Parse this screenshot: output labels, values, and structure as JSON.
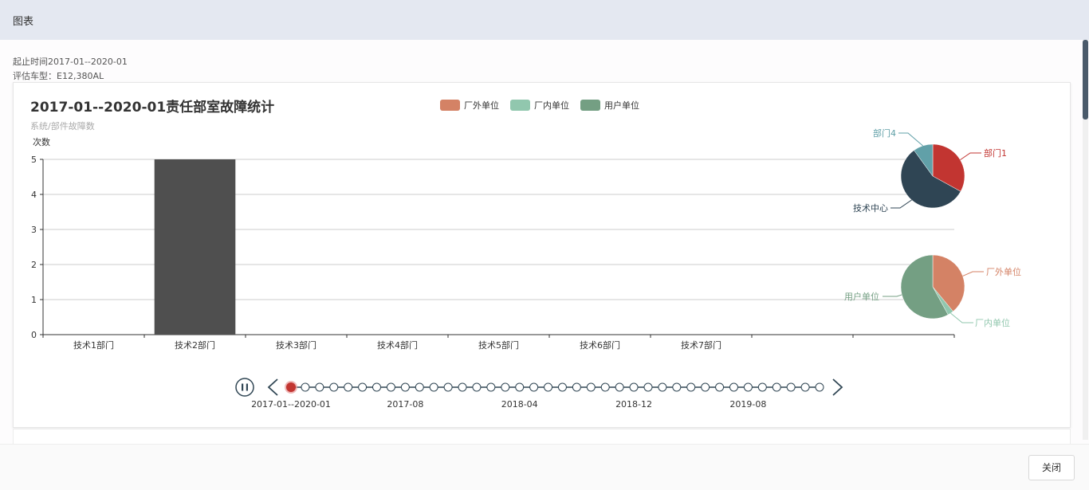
{
  "header": {
    "title": "图表"
  },
  "info": {
    "time_range": "起止时间2017-01--2020-01",
    "vehicle_model": "评估车型：E12,380AL"
  },
  "chart": {
    "title": "2017-01--2020-01责任部室故障统计",
    "subtitle": "系统/部件故障数",
    "legend": [
      {
        "name": "厂外单位",
        "color": "#d48265"
      },
      {
        "name": "厂内单位",
        "color": "#91c7ae"
      },
      {
        "name": "用户单位",
        "color": "#749f83"
      }
    ]
  },
  "chart_data": [
    {
      "type": "bar",
      "title": "2017-01--2020-01责任部室故障统计",
      "subtitle": "系统/部件故障数",
      "ylabel": "次数",
      "ylim": [
        0,
        5
      ],
      "yticks": [
        0,
        1,
        2,
        3,
        4,
        5
      ],
      "categories": [
        "技术1部门",
        "技术2部门",
        "技术3部门",
        "技术4部门",
        "技术5部门",
        "技术6部门",
        "技术7部门",
        "",
        ""
      ],
      "values": [
        0,
        5,
        0,
        0,
        0,
        0,
        0,
        0,
        0
      ],
      "bar_color": "#4f4f4f",
      "grid": true
    },
    {
      "type": "pie",
      "labels": [
        "部门1",
        "技术中心",
        "部门4"
      ],
      "values": [
        33,
        57,
        10
      ],
      "colors": [
        "#c23531",
        "#2f4554",
        "#61a0a8"
      ]
    },
    {
      "type": "pie",
      "labels": [
        "厂外单位",
        "厂内单位",
        "用户单位"
      ],
      "values": [
        39,
        3,
        58
      ],
      "colors": [
        "#d48265",
        "#91c7ae",
        "#749f83"
      ]
    }
  ],
  "timeline": {
    "labels": [
      "2017-01--2020-01",
      "2017-08",
      "2018-04",
      "2018-12",
      "2019-08"
    ],
    "point_count": 38,
    "current_index": 0
  },
  "footer": {
    "close_label": "关闭"
  }
}
